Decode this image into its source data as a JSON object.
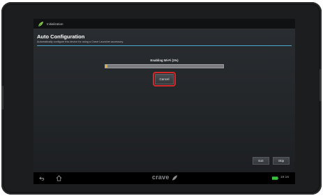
{
  "titlebar": {
    "title": "Initialization",
    "icon": "crave-leaf-icon"
  },
  "header": {
    "title": "Auto Configuration",
    "subtitle": "Automatically configure this device for using a Crave Launcher accessory."
  },
  "progress": {
    "label": "Enabling Wi-Fi (1%)",
    "value": 0.01
  },
  "buttons": {
    "cancel": "Cancel",
    "exit": "Exit",
    "skip": "Skip"
  },
  "navbar": {
    "brand": "crave",
    "time": "19:16"
  },
  "colors": {
    "accent": "#4ab8e0",
    "progress": "#e7b01c",
    "highlight": "#d42a2a",
    "battery": "#37c23a"
  }
}
